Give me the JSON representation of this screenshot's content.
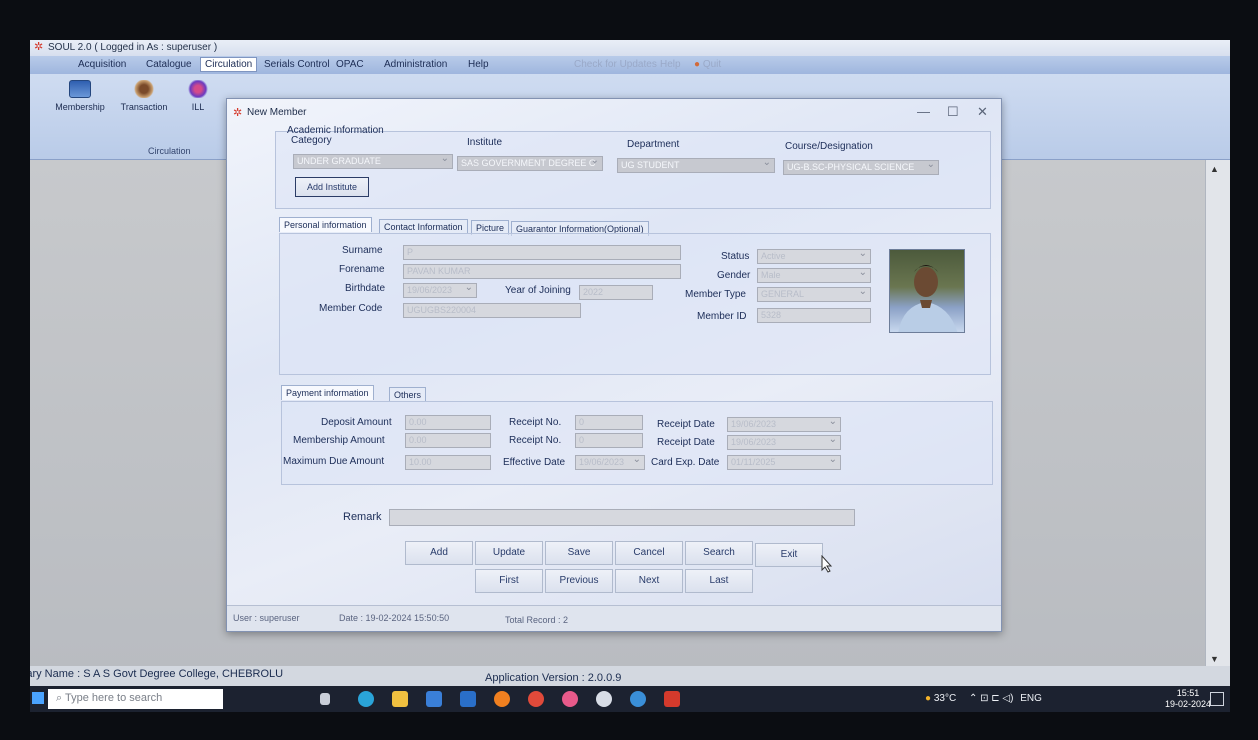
{
  "app": {
    "title": "SOUL 2.0  ( Logged in As : superuser )",
    "menu": [
      "Acquisition",
      "Catalogue",
      "Circulation",
      "Serials Control",
      "OPAC",
      "Administration",
      "Help"
    ],
    "menu_grey": [
      "Check for Updates",
      "Help",
      "Quit"
    ],
    "ribbon": [
      "Membership",
      "Transaction",
      "ILL"
    ],
    "ribbon_group": "Circulation",
    "library_name": "Library Name : S A S Govt Degree College, CHEBROLU",
    "version": "Application Version : 2.0.0.9"
  },
  "dialog": {
    "title": "New Member",
    "academic": {
      "legend": "Academic Information",
      "category_label": "Category",
      "institute_label": "Institute",
      "department_label": "Department",
      "course_label": "Course/Designation",
      "category": "UNDER GRADUATE",
      "institute": "SAS GOVERNMENT DEGREE C",
      "department": "UG STUDENT",
      "course": "UG-B.SC-PHYSICAL SCIENCE",
      "add_institute": "Add Institute"
    },
    "tabs": [
      "Personal information",
      "Contact Information",
      "Picture",
      "Guarantor Information(Optional)"
    ],
    "personal": {
      "surname_label": "Surname",
      "surname": "P",
      "forename_label": "Forename",
      "forename": "PAVAN KUMAR",
      "birthdate_label": "Birthdate",
      "birthdate": "19/06/2023",
      "year_label": "Year of Joining",
      "year": "2022",
      "member_code_label": "Member Code",
      "member_code": "UGUGBS220004",
      "status_label": "Status",
      "status": "Active",
      "gender_label": "Gender",
      "gender": "Male",
      "member_type_label": "Member Type",
      "member_type": "GENERAL",
      "member_id_label": "Member ID",
      "member_id": "5328"
    },
    "payment_tabs": [
      "Payment information",
      "Others"
    ],
    "payment": {
      "deposit_label": "Deposit Amount",
      "deposit": "0.00",
      "membership_label": "Membership Amount",
      "membership": "0.00",
      "max_due_label": "Maximum Due Amount",
      "max_due": "10.00",
      "receipt1_label": "Receipt No.",
      "receipt1": "0",
      "receipt2_label": "Receipt No.",
      "receipt2": "0",
      "effective_label": "Effective Date",
      "effective": "19/06/2023",
      "rdate1_label": "Receipt Date",
      "rdate1": "19/06/2023",
      "rdate2_label": "Receipt Date",
      "rdate2": "19/06/2023",
      "card_exp_label": "Card Exp. Date",
      "card_exp": "01/11/2025"
    },
    "remark_label": "Remark",
    "buttons_row1": [
      "Add",
      "Update",
      "Save",
      "Cancel",
      "Search",
      "Exit"
    ],
    "buttons_row2": [
      "First",
      "Previous",
      "Next",
      "Last"
    ],
    "status": {
      "user": "User : superuser",
      "date": "Date : 19-02-2024 15:50:50",
      "total": "Total Record : 2"
    }
  },
  "taskbar": {
    "search_placeholder": "Type here to search",
    "weather": "33°C",
    "lang": "ENG",
    "time": "15:51",
    "date": "19-02-2024"
  },
  "colors": {
    "accent": "#1f4fa3",
    "dialog_bg": "#e4eaf6",
    "taskbar": "#1c2230"
  }
}
